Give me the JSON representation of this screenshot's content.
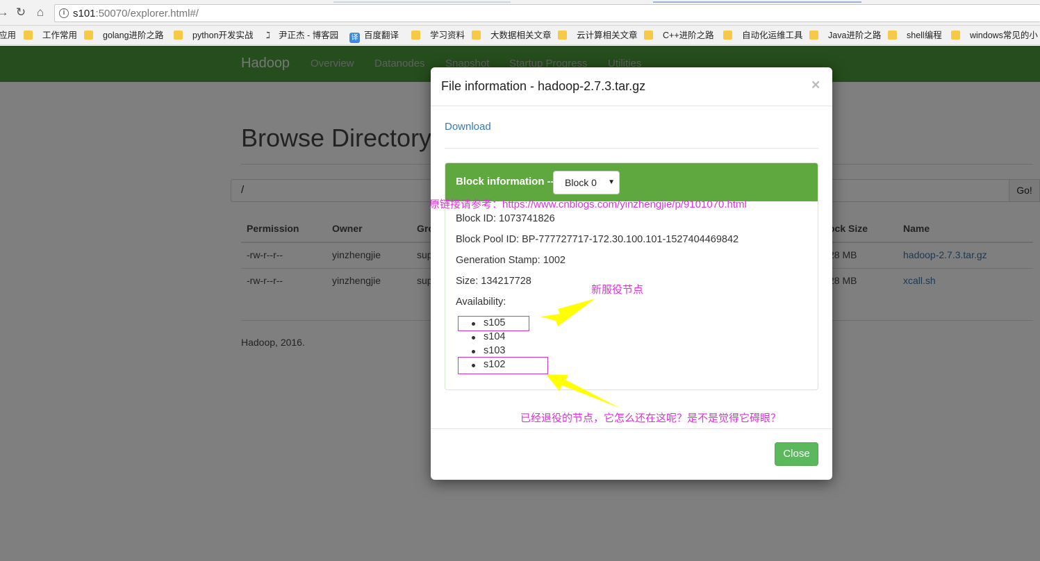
{
  "browser": {
    "url_host": "s101",
    "url_rest": ":50070/explorer.html#/",
    "bookmarks": [
      "应用",
      "工作常用",
      "golang进阶之路",
      "python开发实战",
      "尹正杰 - 博客园",
      "百度翻译",
      "学习资料",
      "大数据相关文章",
      "云计算相关文章",
      "C++进阶之路",
      "自动化运维工具",
      "Java进阶之路",
      "shell编程",
      "windows常见的小"
    ],
    "yi_icon_text": "译"
  },
  "navbar": {
    "brand": "Hadoop",
    "links": [
      "Overview",
      "Datanodes",
      "Snapshot",
      "Startup Progress",
      "Utilities"
    ]
  },
  "page": {
    "title": "Browse Directory",
    "path_value": "/",
    "go_label": "Go!",
    "columns": {
      "permission": "Permission",
      "owner": "Owner",
      "group": "Gro",
      "block_size": "ock Size",
      "name": "Name"
    },
    "rows": [
      {
        "permission": "-rw-r--r--",
        "owner": "yinzhengjie",
        "group": "sup",
        "size": "28 MB",
        "name": "hadoop-2.7.3.tar.gz"
      },
      {
        "permission": "-rw-r--r--",
        "owner": "yinzhengjie",
        "group": "sup",
        "size": "28 MB",
        "name": "xcall.sh"
      }
    ],
    "footer": "Hadoop, 2016."
  },
  "modal": {
    "title": "File information - hadoop-2.7.3.tar.gz",
    "close_x": "×",
    "download": "Download",
    "block_label": "Block information --",
    "block_selected": "Block 0",
    "block_id": "Block ID: 1073741826",
    "pool_id": "Block Pool ID: BP-777727717-172.30.100.101-1527404469842",
    "gen_stamp": "Generation Stamp: 1002",
    "size": "Size: 134217728",
    "availability": "Availability:",
    "nodes": [
      "s105",
      "s104",
      "s103",
      "s102"
    ],
    "close_button": "Close"
  },
  "annotations": {
    "watermark": "原链接请参考：https://www.cnblogs.com/yinzhengjie/p/9101070.html",
    "new_node": "新服役节点",
    "retired_node": "已经退役的节点，它怎么还在这呢？是不是觉得它碍眼？",
    "color": "#e030e0",
    "arrow_color": "#ffff00"
  }
}
